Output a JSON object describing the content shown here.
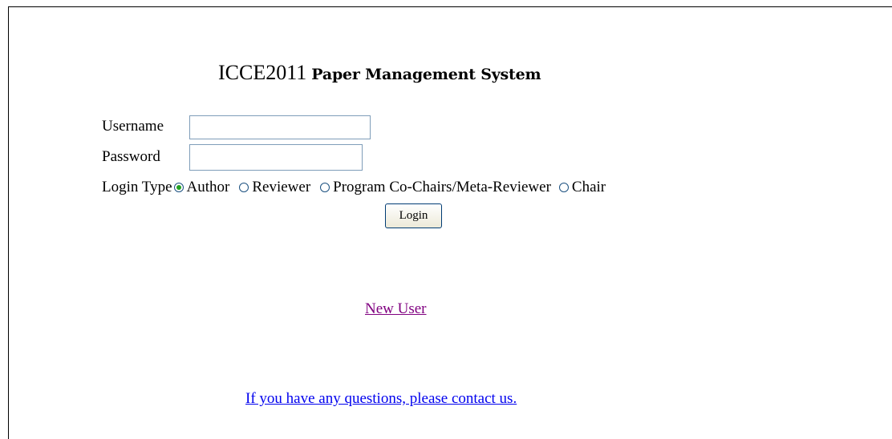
{
  "header": {
    "title": "ICCE2011",
    "subtitle": "Paper Management System"
  },
  "form": {
    "username_label": "Username",
    "username_value": "",
    "password_label": "Password",
    "password_value": "",
    "login_type_label": "Login Type",
    "login_types": [
      {
        "label": "Author",
        "checked": true
      },
      {
        "label": "Reviewer",
        "checked": false
      },
      {
        "label": "Program Co-Chairs/Meta-Reviewer",
        "checked": false
      },
      {
        "label": "Chair",
        "checked": false
      }
    ],
    "login_button_label": "Login"
  },
  "links": {
    "new_user": "New User",
    "contact": "If you have any questions, please contact us."
  },
  "colors": {
    "visited_link": "#800080",
    "link": "#0000ee",
    "input_border": "#7f9db9",
    "radio_checked": "#21a121"
  }
}
